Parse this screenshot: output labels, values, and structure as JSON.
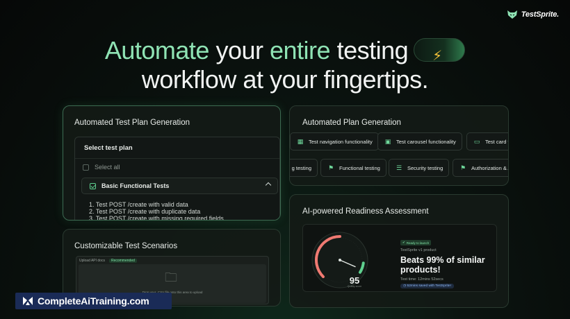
{
  "brand": {
    "name": "TestSprite.",
    "icon": "fox-icon"
  },
  "headline": {
    "w1": "Automate",
    "w2": " your ",
    "w3": "entire",
    "w4": " testing",
    "line2": "workflow at your fingertips.",
    "pill_icon": "lightning-bolt-icon",
    "accent_color": "#8fe3b4"
  },
  "plan_card": {
    "title": "Automated Test Plan Generation",
    "panel_title": "Select test plan",
    "select_all": "Select all",
    "group_label": "Basic Functional Tests",
    "tests": [
      "1. Test POST /create with valid data",
      "2. Test POST /create with duplicate data",
      "3. Test POST /create with missing required fields"
    ]
  },
  "generation_card": {
    "title": "Automated Plan Generation",
    "row1": [
      {
        "label": "Test navigation functionality",
        "icon": "grid-icon"
      },
      {
        "label": "Test carousel functionality",
        "icon": "carousel-icon"
      },
      {
        "label": "Test card f",
        "icon": "monitor-icon"
      }
    ],
    "row2": [
      {
        "label": "g testing",
        "icon": ""
      },
      {
        "label": "Functional testing",
        "icon": "flag-icon"
      },
      {
        "label": "Security testing",
        "icon": "list-icon"
      },
      {
        "label": "Authorization & A",
        "icon": "flag-icon"
      }
    ]
  },
  "scenarios_card": {
    "title": "Customizable Test Scenarios",
    "tab_label": "Upload API docs",
    "recommended": "Recommended",
    "drop_text": "Drop your .CSV file onto this area to upload",
    "folder_icon": "folder-icon"
  },
  "readiness_card": {
    "title": "AI-powered Readiness Assessment",
    "score": "95",
    "score_label": "Quality score",
    "score_fraction": 0.95,
    "ready_badge": "Ready to launch",
    "product": "TestSprite v1 product",
    "beats": "Beats 99% of similar products!",
    "test_time": "Test time: 12mins 52secs",
    "saved": "52mins saved with TestSprite!"
  },
  "watermark": {
    "text": "CompleteAiTraining.com"
  }
}
